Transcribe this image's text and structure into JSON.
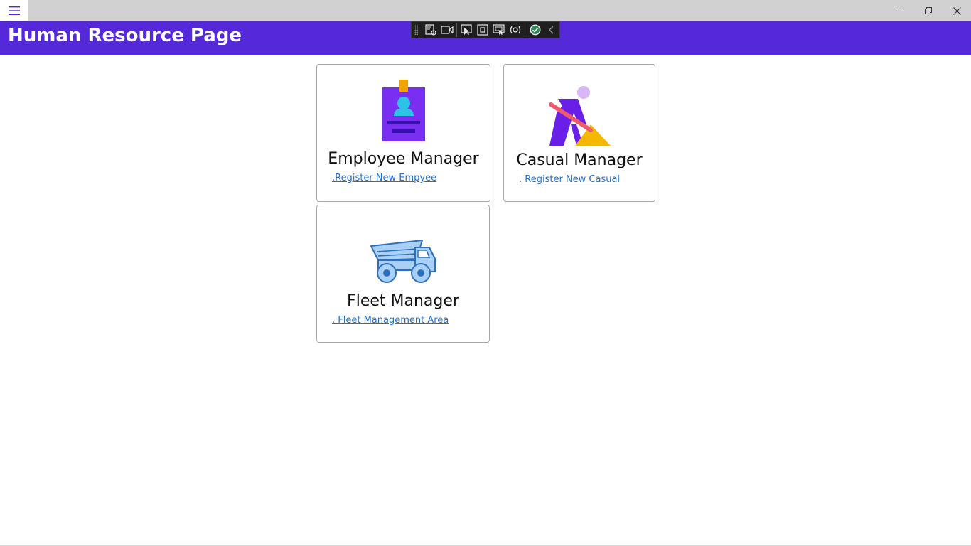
{
  "window": {
    "menu_icon": "hamburger-icon",
    "controls": [
      "minimize-icon",
      "restore-icon",
      "close-icon"
    ]
  },
  "header": {
    "title": "Human Resource Page",
    "background": "#5529d9"
  },
  "devtoolbar": {
    "icons": [
      "live-visual-tree-icon",
      "record-icon",
      "select-element-icon",
      "display-layout-adorners-icon",
      "track-focus-icon",
      "binding-failures-icon",
      "hot-reload-check-icon",
      "collapse-chevron-icon"
    ]
  },
  "cards": [
    {
      "title": "Employee Manager",
      "link": ".Register New Empyee",
      "icon": "id-badge-icon"
    },
    {
      "title": "Casual Manager",
      "link": ". Register New Casual",
      "icon": "digging-worker-icon"
    },
    {
      "title": "Fleet Manager",
      "link": ". Fleet Management Area",
      "icon": "dump-truck-icon"
    }
  ],
  "colors": {
    "accent": "#5529d9",
    "link": "#1f6fd6"
  }
}
